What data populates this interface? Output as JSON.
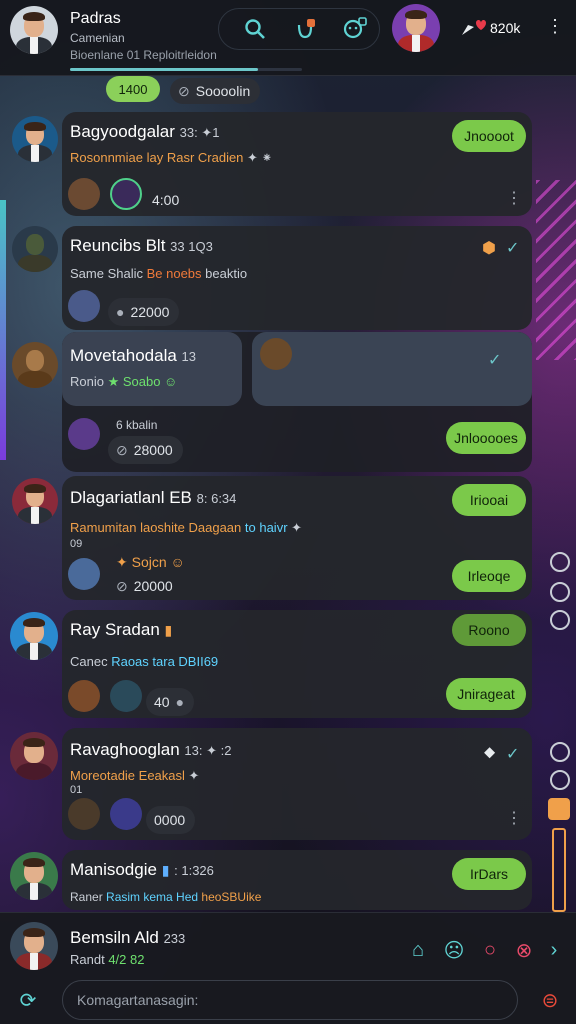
{
  "header": {
    "title": "Padras",
    "subtitle": "Camenian",
    "status": "Bioenlane 01 Reploitrleidon",
    "progress": 0.81,
    "count": "820k"
  },
  "top_strip": {
    "badge": "1400",
    "counter": "Soooolin"
  },
  "chats": [
    {
      "title": "Bagyoodgalar",
      "meta": "33: ✦1",
      "sub_a": "Rosonnmiae lay Rasr Cradien",
      "sub_b": "✦ ⁕",
      "button": "Jnoooot",
      "counter": "4:00"
    },
    {
      "title": "Reuncibs Blt",
      "meta": "33 1Q3",
      "sub_a": "Same Shalic ",
      "sub_b": "Be noebs ",
      "sub_c": "beaktio",
      "counter": "22000"
    },
    {
      "title": "Movetahodala",
      "meta": "13",
      "sub_a": "Ronio ",
      "sub_b": "★ Soabo ☺",
      "online": "6 kbalin",
      "button": "Jnlooooes",
      "counter": "28000"
    },
    {
      "title": "Dlagariatlanl EB",
      "meta": "8: 6:34",
      "sub_a": "Ramumitan laoshite Daagaan ",
      "sub_b": "to haivr",
      "sub_c": " ✦",
      "sub_line2": "09",
      "tag": "✦ Sojcn ☺",
      "button": "Iriooai",
      "button2": "Irleoqe",
      "counter": "20000"
    },
    {
      "title": "Ray Sradan",
      "meta": "",
      "sub_a": "Canec ",
      "sub_b": "Raoas tara DBII69",
      "button": "Roono",
      "button2": "Jnirageat",
      "counter": "40"
    },
    {
      "title": "Ravaghooglan",
      "meta": "13: ✦ :2",
      "sub_a": "Moreotadie Eeakasl",
      "sub_b": " ✦",
      "sub_line2": "01",
      "counter": "0000"
    },
    {
      "title": "Manisodgie",
      "meta": ": 1:326",
      "sub_a": "Raner ",
      "sub_b": "Rasim kema Hed ",
      "sub_c": "heoSBUike",
      "button": "IrDars"
    }
  ],
  "footer": {
    "name": "Bemsiln Ald",
    "meta": "233",
    "sub_a": "Randt ",
    "sub_b": "4/2 82",
    "composer_placeholder": "Komagartanasagin:"
  },
  "colors": {
    "accent": "#6cc6c9",
    "green": "#7bc94a",
    "orange": "#f0a04a"
  }
}
